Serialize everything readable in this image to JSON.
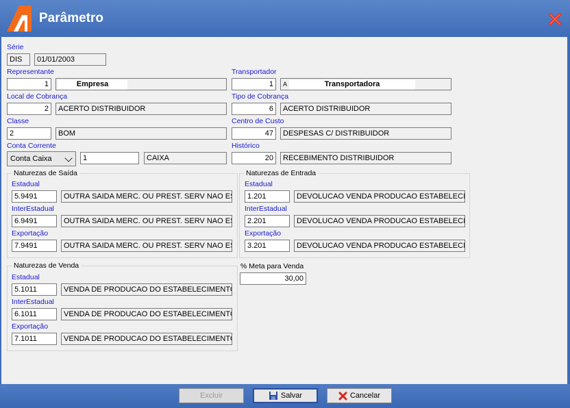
{
  "window": {
    "title": "Parâmetro",
    "accent": "#4a76c0",
    "label_color": "#1a1ad0"
  },
  "serie": {
    "label": "Série",
    "code": "DIS",
    "date": "01/01/2003"
  },
  "representante": {
    "label": "Representante",
    "code": "1",
    "name": "Empresa"
  },
  "transportador": {
    "label": "Transportador",
    "code": "1",
    "prefix": "A",
    "name": "Transportadora"
  },
  "local_cobranca": {
    "label": "Local de Cobrança",
    "code": "2",
    "name": "ACERTO DISTRIBUIDOR"
  },
  "tipo_cobranca": {
    "label": "Tipo de Cobrança",
    "code": "6",
    "name": "ACERTO DISTRIBUIDOR"
  },
  "classe": {
    "label": "Classe",
    "code": "2",
    "name": "BOM"
  },
  "centro_custo": {
    "label": "Centro de Custo",
    "code": "47",
    "name": "DESPESAS C/ DISTRIBUIDOR"
  },
  "conta_corrente": {
    "label": "Conta Corrente",
    "type": "Conta Caixa",
    "code": "1",
    "name": "CAIXA"
  },
  "historico": {
    "label": "Histórico",
    "code": "20",
    "name": "RECEBIMENTO DISTRIBUIDOR"
  },
  "naturezas_saida": {
    "title": "Naturezas de Saída",
    "rows": [
      {
        "label": "Estadual",
        "code": "5.9491",
        "desc": "OUTRA SAIDA MERC. OU PREST. SERV NAO ES"
      },
      {
        "label": "InterEstadual",
        "code": "6.9491",
        "desc": "OUTRA SAIDA MERC. OU PREST. SERV NAO ES"
      },
      {
        "label": "Exportação",
        "code": "7.9491",
        "desc": "OUTRA SAIDA MERC. OU PREST. SERV NAO ES"
      }
    ]
  },
  "naturezas_entrada": {
    "title": "Naturezas de Entrada",
    "rows": [
      {
        "label": "Estadual",
        "code": "1.201",
        "desc": "DEVOLUCAO VENDA PRODUCAO ESTABELECIM"
      },
      {
        "label": "InterEstadual",
        "code": "2.201",
        "desc": "DEVOLUCAO VENDA PRODUCAO ESTABELECIM"
      },
      {
        "label": "Exportação",
        "code": "3.201",
        "desc": "DEVOLUCAO VENDA PRODUCAO ESTABELECIM"
      }
    ]
  },
  "naturezas_venda": {
    "title": "Naturezas de Venda",
    "rows": [
      {
        "label": "Estadual",
        "code": "5.1011",
        "desc": "VENDA DE PRODUCAO DO ESTABELECIMENTO"
      },
      {
        "label": "InterEstadual",
        "code": "6.1011",
        "desc": "VENDA DE PRODUCAO DO ESTABELECIMENTO"
      },
      {
        "label": "Exportação",
        "code": "7.1011",
        "desc": "VENDA DE PRODUCAO DO ESTABELECIMENTO"
      }
    ]
  },
  "meta_venda": {
    "label": "% Meta para Venda",
    "value": "30,00"
  },
  "buttons": {
    "excluir": "Excluir",
    "salvar": "Salvar",
    "cancelar": "Cancelar"
  }
}
